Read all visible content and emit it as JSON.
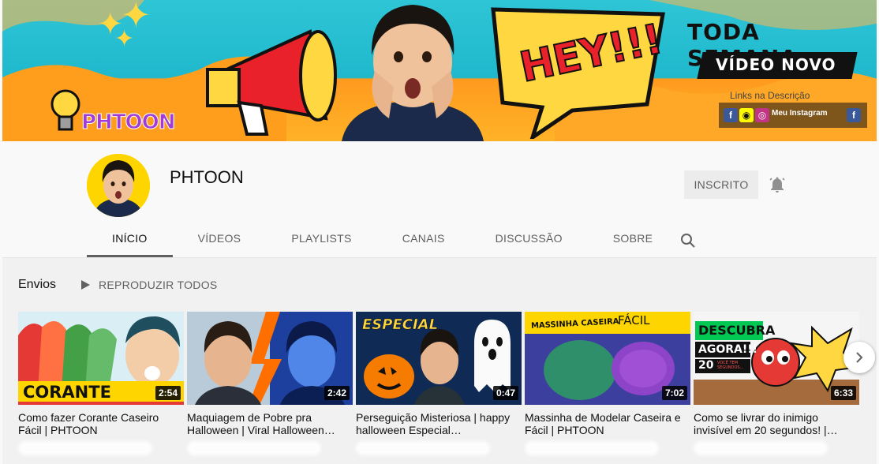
{
  "banner": {
    "logo_text": "PHTOON",
    "shout_text": "HEY!!!",
    "headline_top": "TODA SEMANA",
    "headline_bottom": "VÍDEO NOVO",
    "links_text": "Links na Descrição",
    "instagram_label": "Meu Instagram"
  },
  "channel": {
    "name": "PHTOON",
    "subscribe_label": "INSCRITO"
  },
  "tabs": [
    {
      "label": "INÍCIO",
      "active": true
    },
    {
      "label": "VÍDEOS"
    },
    {
      "label": "PLAYLISTS"
    },
    {
      "label": "CANAIS"
    },
    {
      "label": "DISCUSSÃO"
    },
    {
      "label": "SOBRE"
    }
  ],
  "section": {
    "title": "Envios",
    "play_all_label": "REPRODUZIR TODOS"
  },
  "videos": [
    {
      "title": "Como fazer Corante Caseiro Fácil | PHTOON",
      "duration": "2:54",
      "thumb_text": "CORANTE"
    },
    {
      "title": "Maquiagem de Pobre pra Halloween | Viral Halloween…",
      "duration": "2:42"
    },
    {
      "title": "Perseguição Misteriosa | happy halloween Especial…",
      "duration": "0:47",
      "thumb_text": "ESPECIAL"
    },
    {
      "title": "Massinha de Modelar Caseira e Fácil | PHTOON",
      "duration": "7:02",
      "thumb_text_1": "MASSINHA CASEIRA",
      "thumb_text_2": "FÁCIL"
    },
    {
      "title": "Como se livrar do inimigo invisível em 20 segundos! |…",
      "duration": "6:33",
      "thumb_text_1": "DESCUBRA",
      "thumb_text_2": "AGORA!!!",
      "thumb_text_3": "20",
      "thumb_text_4": "VOCÊ TEM SEGUNDOS..."
    }
  ],
  "colors": {
    "banner_cyan": "#2ec5d6",
    "banner_orange": "#ffa726",
    "avatar_yellow": "#ffd500",
    "subscribe_bg": "#ececec"
  }
}
